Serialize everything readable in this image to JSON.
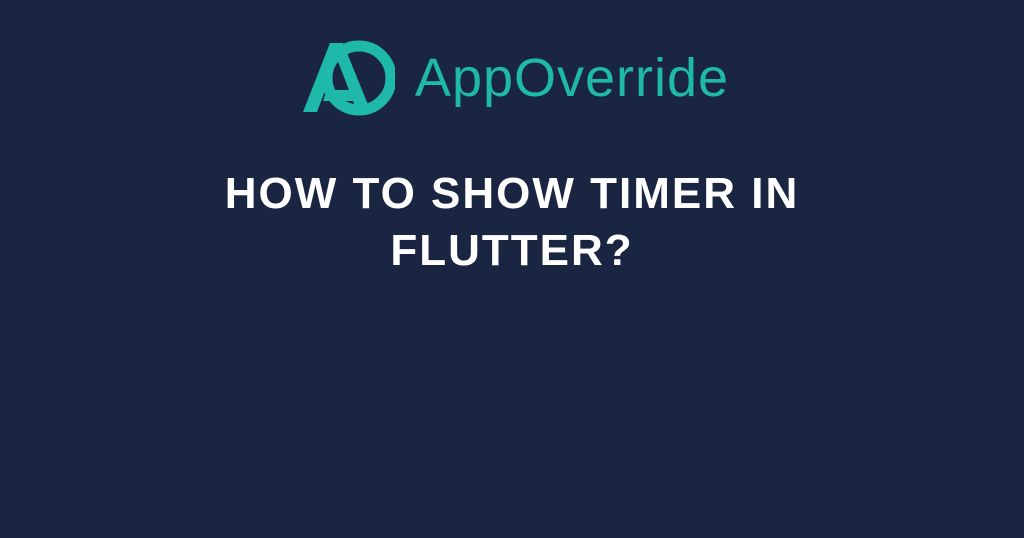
{
  "brand": {
    "name": "AppOverride",
    "accent_color": "#1fb9a9"
  },
  "headline": "HOW TO SHOW TIMER IN FLUTTER?"
}
